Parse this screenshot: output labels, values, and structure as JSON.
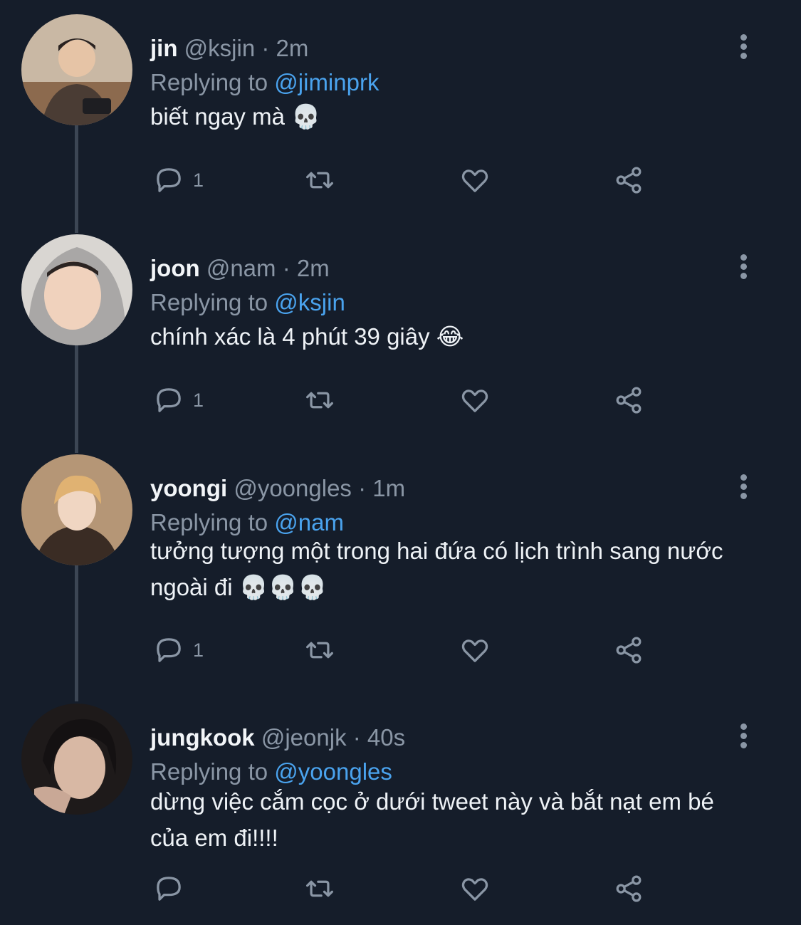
{
  "colors": {
    "background": "#151d2a",
    "accent": "#4aa3ee",
    "muted": "#8a96a5"
  },
  "tweets": [
    {
      "name": "jin",
      "handle": "@ksjin",
      "dot": "·",
      "time": "2m",
      "reply_prefix": "Replying to",
      "reply_to": "@jiminprk",
      "text": "biết ngay mà 💀",
      "reply_count": "1",
      "icons": [
        "reply-icon",
        "retweet-icon",
        "like-icon",
        "share-icon",
        "more-icon"
      ]
    },
    {
      "name": "joon",
      "handle": "@nam",
      "dot": "·",
      "time": "2m",
      "reply_prefix": "Replying to",
      "reply_to": "@ksjin",
      "text": "chính xác là 4 phút 39 giây 😂",
      "reply_count": "1",
      "icons": [
        "reply-icon",
        "retweet-icon",
        "like-icon",
        "share-icon",
        "more-icon"
      ]
    },
    {
      "name": "yoongi",
      "handle": "@yoongles",
      "dot": "·",
      "time": "1m",
      "reply_prefix": "Replying to",
      "reply_to": "@nam",
      "text": "tưởng tượng một trong hai đứa có lịch trình sang nước ngoài đi 💀💀💀",
      "reply_count": "1",
      "icons": [
        "reply-icon",
        "retweet-icon",
        "like-icon",
        "share-icon",
        "more-icon"
      ]
    },
    {
      "name": "jungkook",
      "handle": "@jeonjk",
      "dot": "·",
      "time": "40s",
      "reply_prefix": "Replying to",
      "reply_to": "@yoongles",
      "text": "dừng việc cắm cọc ở dưới tweet này và bắt nạt em bé của em đi!!!!",
      "reply_count": "",
      "icons": [
        "reply-icon",
        "retweet-icon",
        "like-icon",
        "share-icon",
        "more-icon"
      ]
    }
  ]
}
